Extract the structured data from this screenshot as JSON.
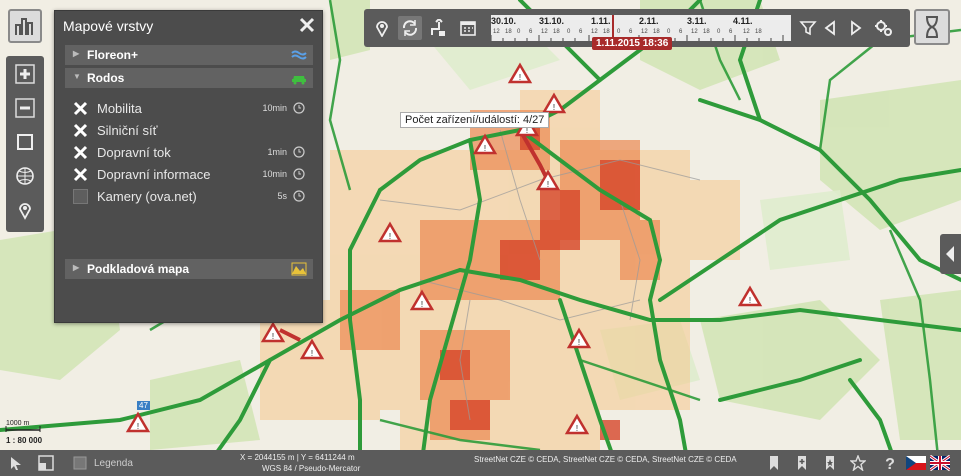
{
  "panel": {
    "title": "Mapové vrstvy",
    "sections": {
      "floreon": "Floreon+",
      "rodos": "Rodos",
      "podkladova": "Podkladová mapa"
    },
    "layers": [
      {
        "label": "Mobilita",
        "time": "10min",
        "checked": true
      },
      {
        "label": "Silniční síť",
        "time": "",
        "checked": true
      },
      {
        "label": "Dopravní tok",
        "time": "1min",
        "checked": true
      },
      {
        "label": "Dopravní informace",
        "time": "10min",
        "checked": true
      },
      {
        "label": "Kamery (ova.net)",
        "time": "5s",
        "checked": false
      }
    ]
  },
  "timeline": {
    "days": [
      "30.10.",
      "31.10.",
      "1.11.",
      "2.11.",
      "3.11.",
      "4.11."
    ],
    "hours": [
      "12",
      "18",
      "0",
      "6",
      "12",
      "18",
      "0",
      "6",
      "12",
      "18",
      "0",
      "6",
      "12",
      "18",
      "0",
      "6",
      "12",
      "18",
      "0",
      "6",
      "12",
      "18"
    ],
    "current": "1.11.2015 18:36"
  },
  "map": {
    "tooltip": "Počet zařízení/událostí: 4/27",
    "scale_label": "1000 m",
    "scale_ratio": "1 : 80 000",
    "road_label": "47"
  },
  "bottom": {
    "legend": "Legenda",
    "coords": "X = 2044155 m | Y = 6411244 m",
    "projection": "WGS 84 / Pseudo-Mercator",
    "attribution": "StreetNet CZE © CEDA, StreetNet CZE © CEDA, StreetNet CZE © CEDA"
  },
  "colors": {
    "road_green": "#2e9b3a",
    "heat_dark": "#d7462a",
    "heat_mid": "#ec8a52",
    "heat_light": "#f6c98e",
    "panel_bg": "#4c4c4c",
    "timestamp_bg": "#a82b2b"
  },
  "icons": [
    "pin-icon",
    "refresh-icon",
    "route-icon",
    "calendar-icon",
    "filter-icon",
    "prev-icon",
    "next-icon",
    "settings-icon",
    "hourglass-icon",
    "zoom-in-icon",
    "zoom-out-icon",
    "select-area-icon",
    "globe-icon",
    "location-icon",
    "close-icon"
  ]
}
